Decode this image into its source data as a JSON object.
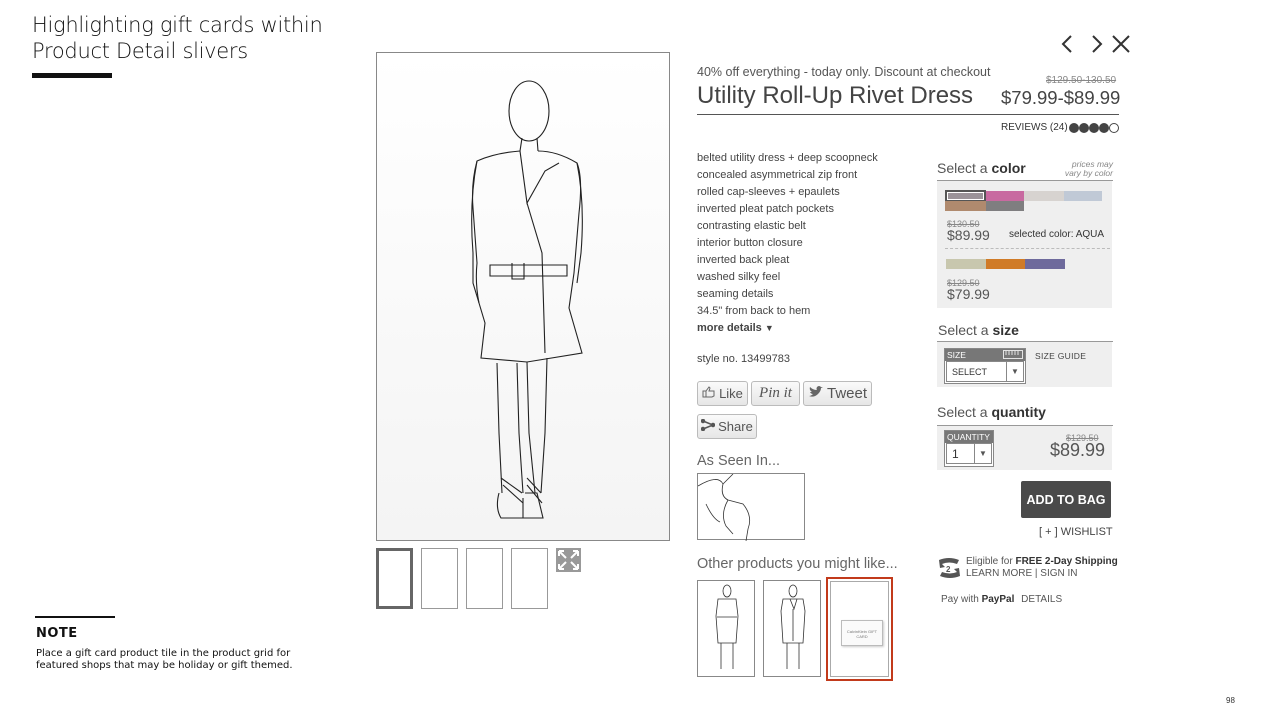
{
  "slide": {
    "title": "Highlighting gift cards within Product Detail slivers",
    "note_heading": "NOTE",
    "note_text": "Place a gift card product tile in the product grid for featured shops that may be holiday or gift themed.",
    "page_number": "98"
  },
  "nav": {
    "prev_icon": "chevron-left-icon",
    "next_icon": "chevron-right-icon",
    "close_icon": "close-icon"
  },
  "product": {
    "promo": "40% off everything - today only. Discount at checkout",
    "title": "Utility Roll-Up Rivet Dress",
    "original_price_range": "$129.50-130.50",
    "price_range": "$79.99-$89.99",
    "reviews_label": "REVIEWS (24)",
    "rating": {
      "filled": 4,
      "total": 5
    },
    "features": [
      "belted utility dress + deep scoopneck",
      "concealed asymmetrical zip front",
      "rolled cap-sleeves + epaulets",
      "inverted pleat patch pockets",
      "contrasting elastic belt",
      "interior button closure",
      "inverted back pleat",
      "washed silky feel",
      "seaming details",
      "34.5\" from back to hem"
    ],
    "more_details": "more details",
    "style_no": "style no. 13499783"
  },
  "social": {
    "like": "Like",
    "pin": "Pin it",
    "tweet": "Tweet",
    "share": "Share"
  },
  "as_seen_in": "As Seen In...",
  "other_products": {
    "heading": "Other products you might like...",
    "giftcard_label": "CalvinKlein GIFT CARD"
  },
  "color": {
    "label_prefix": "Select a",
    "label_bold": "color",
    "prices_note": "prices may vary by color",
    "group1": {
      "swatches": [
        "#9b9399",
        "#c86aa0",
        "#d7d3d0",
        "#c0c9d6",
        "#b08a6e",
        "#7f7e80"
      ],
      "original": "$130.50",
      "price": "$89.99",
      "selected_text": "selected color: AQUA"
    },
    "group2": {
      "swatches": [
        "#c8c7ae",
        "#d07b27",
        "#6e6a9c"
      ],
      "original": "$129.50",
      "price": "$79.99"
    }
  },
  "size": {
    "label_prefix": "Select a",
    "label_bold": "size",
    "box_label": "SIZE",
    "select_value": "SELECT",
    "guide": "SIZE  GUIDE"
  },
  "quantity": {
    "label_prefix": "Select a",
    "label_bold": "quantity",
    "box_label": "QUANTITY",
    "value": "1",
    "original": "$129.50",
    "price": "$89.99"
  },
  "actions": {
    "add_to_bag": "ADD TO BAG",
    "wishlist": "[ + ] WISHLIST"
  },
  "shipping": {
    "prefix": "Eligible for ",
    "bold": "FREE 2-Day Shipping",
    "links": "LEARN MORE | SIGN IN"
  },
  "paypal": {
    "prefix": "Pay with ",
    "bold": "PayPal",
    "details": "DETAILS"
  }
}
